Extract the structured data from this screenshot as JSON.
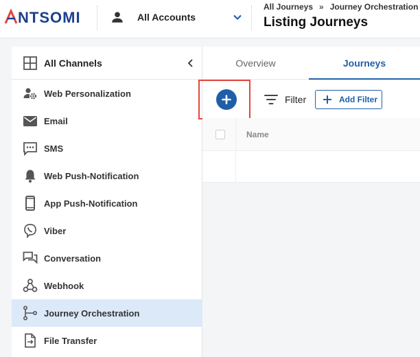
{
  "brand": {
    "logo_text": "ANTSOMI",
    "accent": "#1f5fa8",
    "logo_color": "#1d3f8f",
    "logo_mark_color": "#e0463d"
  },
  "header": {
    "account_label": "All Accounts",
    "account_icon": "person-icon",
    "breadcrumb": [
      "All Journeys",
      "Journey Orchestration"
    ],
    "breadcrumb_separator": "»",
    "title": "Listing Journeys"
  },
  "sidebar": {
    "header_label": "All Channels",
    "header_icon": "grid-icon",
    "items": [
      {
        "label": "Web Personalization",
        "icon": "user-gear-icon",
        "active": false
      },
      {
        "label": "Email",
        "icon": "envelope-icon",
        "active": false
      },
      {
        "label": "SMS",
        "icon": "sms-icon",
        "active": false
      },
      {
        "label": "Web Push-Notification",
        "icon": "bell-icon",
        "active": false
      },
      {
        "label": "App Push-Notification",
        "icon": "smartphone-icon",
        "active": false
      },
      {
        "label": "Viber",
        "icon": "viber-icon",
        "active": false
      },
      {
        "label": "Conversation",
        "icon": "chat-icon",
        "active": false
      },
      {
        "label": "Webhook",
        "icon": "webhook-icon",
        "active": false
      },
      {
        "label": "Journey Orchestration",
        "icon": "flow-icon",
        "active": true
      },
      {
        "label": "File Transfer",
        "icon": "file-transfer-icon",
        "active": false
      }
    ]
  },
  "tabs": [
    {
      "label": "Overview",
      "active": false
    },
    {
      "label": "Journeys",
      "active": true
    }
  ],
  "toolbar": {
    "add_icon": "plus-icon",
    "filter_label": "Filter",
    "add_filter_label": "Add Filter",
    "highlight_color": "#e0463d"
  },
  "table": {
    "columns": [
      "Name"
    ]
  }
}
